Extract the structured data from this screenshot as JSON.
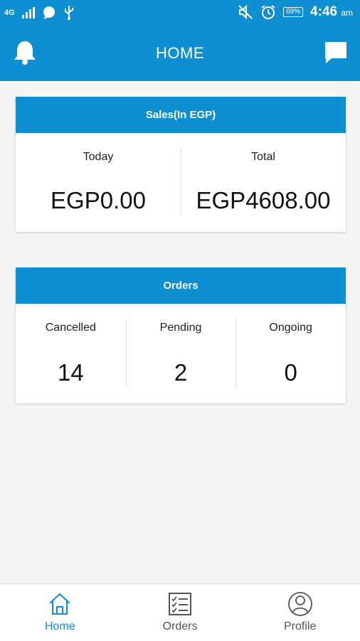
{
  "status_bar": {
    "network": "4G",
    "battery": "69%",
    "time": "4:46",
    "ampm": "am"
  },
  "app_bar": {
    "title": "HOME",
    "left_icon": "bell-icon",
    "right_icon": "chat-icon"
  },
  "sales_card": {
    "title": "Sales(In EGP)",
    "today_label": "Today",
    "today_value": "EGP0.00",
    "total_label": "Total",
    "total_value": "EGP4608.00"
  },
  "orders_card": {
    "title": "Orders",
    "cancelled_label": "Cancelled",
    "cancelled_value": "14",
    "pending_label": "Pending",
    "pending_value": "2",
    "ongoing_label": "Ongoing",
    "ongoing_value": "0"
  },
  "bottom_nav": {
    "items": [
      {
        "label": "Home",
        "icon": "home-icon",
        "active": true
      },
      {
        "label": "Orders",
        "icon": "checklist-icon",
        "active": false
      },
      {
        "label": "Profile",
        "icon": "profile-icon",
        "active": false
      }
    ]
  },
  "colors": {
    "primary": "#0d8fd1",
    "background": "#f5f5f5"
  }
}
